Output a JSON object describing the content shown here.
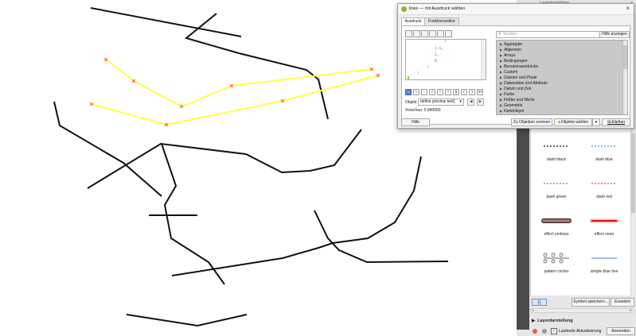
{
  "dialog": {
    "title": "lines — mit Ausdruck wählen",
    "close_glyph": "×",
    "tabs": [
      {
        "label": "Ausdruck"
      },
      {
        "label": "Funktionseditor"
      }
    ],
    "editor_lines": [
      "!",
      "|-a,",
      "2,",
      "0",
      ")",
      ")"
    ],
    "operators": [
      "=",
      "+",
      "-",
      "/",
      "*",
      "^",
      "||",
      "(",
      ")",
      "'\\n'"
    ],
    "object_label": "Objekt",
    "object_value": "define preview text]",
    "preview_label": "Vorschau:",
    "preview_value": "0.000000",
    "search_placeholder": "Suchen",
    "help_show_label": "Hilfe anzeigen",
    "functions": [
      "Aggregate",
      "Allgemein",
      "Arrays",
      "Bedingungen",
      "Benutzerausdrücke",
      "Custom",
      "Dateien und Pfade",
      "Datensätze und Attribute",
      "Datum und Zeit",
      "Farbe",
      "Felder und Werte",
      "Geometrie",
      "Kartenlayer"
    ],
    "help_button": "Hilfe",
    "zoom_button": "Zu Objekten zoomen",
    "select_button": "Objekte wählen",
    "close_button": "Schließen"
  },
  "dock": {
    "top_title": "Layerdarstellung",
    "symbols": [
      {
        "label": "dash black",
        "color": "#111111",
        "style": "dash"
      },
      {
        "label": "dash blue",
        "color": "#4a90d9",
        "style": "dash"
      },
      {
        "label": "dash green",
        "color": "#3bb43b",
        "style": "dash"
      },
      {
        "label": "dash red",
        "color": "#d9453a",
        "style": "dash"
      },
      {
        "label": "effect emboss",
        "color": "#8a5a5a",
        "style": "emboss"
      },
      {
        "label": "effect neon",
        "color": "#e01010",
        "style": "neon"
      },
      {
        "label": "pattern circles",
        "color": "#333333",
        "style": "circles"
      },
      {
        "label": "simple blue line",
        "color": "#6a9de0",
        "style": "solid"
      }
    ],
    "save_symbol_label": "Symbol speichern...",
    "advanced_label": "Erweitert",
    "section_title": "Layerdarstellung",
    "live_update_label": "Laufende Aktualisierung",
    "apply_label": "Anwenden"
  },
  "colors": {
    "line": "#111111",
    "highlight": "#ffff44",
    "vertex": "#ff2a1a"
  }
}
